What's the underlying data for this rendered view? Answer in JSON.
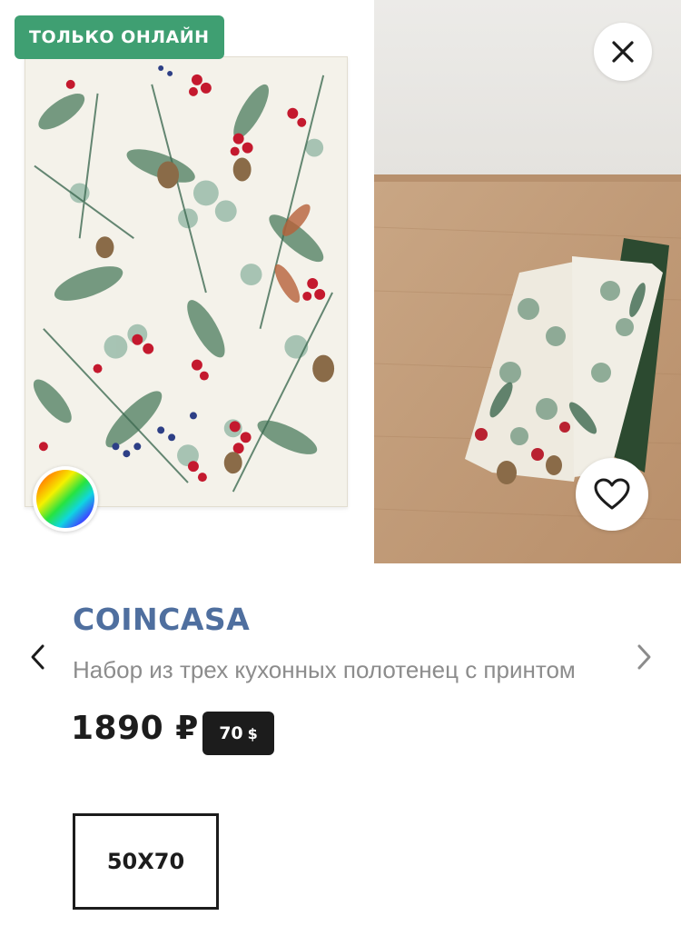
{
  "badge": {
    "label": "ТОЛЬКО ОНЛАЙН",
    "color": "#3f9f72"
  },
  "product": {
    "brand": "COINCASA",
    "title": "Набор из трех кухонных полотенец с принтом",
    "price": "1890 ₽",
    "points": {
      "value": "70",
      "symbol": "$"
    },
    "brand_color": "#4f6f9f"
  },
  "sizes": [
    {
      "label": "50X70",
      "selected": true
    }
  ],
  "icons": {
    "close": "close-icon",
    "favorite": "heart-icon",
    "prev": "chevron-left-icon",
    "next": "chevron-right-icon",
    "color": "color-wheel-icon"
  }
}
